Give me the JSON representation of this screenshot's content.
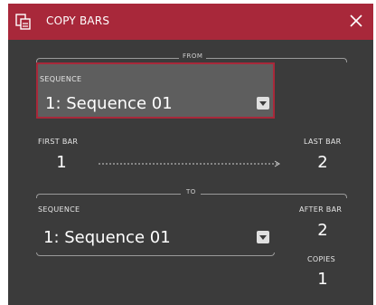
{
  "dialog": {
    "title": "COPY BARS",
    "title_icon": "copy-bars-icon",
    "close_icon": "close-icon"
  },
  "from": {
    "section_label": "FROM",
    "sequence_label": "SEQUENCE",
    "sequence_value": "1: Sequence 01",
    "first_bar_label": "FIRST BAR",
    "first_bar_value": "1",
    "last_bar_label": "LAST BAR",
    "last_bar_value": "2"
  },
  "to": {
    "section_label": "TO",
    "sequence_label": "SEQUENCE",
    "sequence_value": "1: Sequence 01",
    "after_bar_label": "AFTER BAR",
    "after_bar_value": "2",
    "copies_label": "COPIES",
    "copies_value": "1"
  },
  "colors": {
    "accent": "#a8283a",
    "panel": "#3b3b3b",
    "highlight_box": "#5e5e5e"
  }
}
